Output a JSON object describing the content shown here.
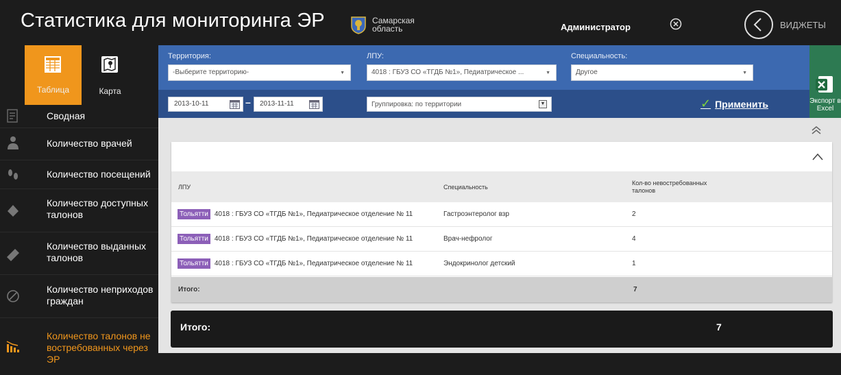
{
  "header": {
    "app_title": "Статистика для мониторинга ЭР",
    "region": "Самарская область",
    "user": "Администратор",
    "widgets": "ВИДЖЕТЫ"
  },
  "views": {
    "table_label": "Таблица",
    "map_label": "Карта"
  },
  "nav": [
    {
      "label": "Сводная",
      "icon": "summary-icon"
    },
    {
      "label": "Количество врачей",
      "icon": "doctor-icon"
    },
    {
      "label": "Количество посещений",
      "icon": "footprints-icon"
    },
    {
      "label": "Количество доступных талонов",
      "icon": "ticket-icon"
    },
    {
      "label": "Количество выданных талонов",
      "icon": "ticket-issued-icon"
    },
    {
      "label": "Количество неприходов граждан",
      "icon": "no-show-icon"
    },
    {
      "label": "Количество талонов не востребованных через ЭР",
      "icon": "unclaimed-chart-icon",
      "active": true
    }
  ],
  "filters": {
    "territory_label": "Территория:",
    "territory_value": "-Выберите территорию-",
    "lpu_label": "ЛПУ:",
    "lpu_value": "4018 : ГБУЗ СО «ТГДБ №1», Педиатрическое ...",
    "specialty_label": "Специальность:",
    "specialty_value": "Другое",
    "date_from": "2013-10-11",
    "date_to": "2013-11-11",
    "grouping": "Группировка: по территории",
    "apply": "Применить",
    "export": "Экспорт в Excel"
  },
  "table": {
    "columns": [
      "ЛПУ",
      "Специальность",
      "Кол-во невостребованных талонов"
    ],
    "rows": [
      {
        "city": "Тольятти",
        "lpu": "4018 : ГБУЗ СО «ТГДБ №1», Педиатрическое отделение № 11",
        "specialty": "Гастроэнтеролог взр",
        "count": "2"
      },
      {
        "city": "Тольятти",
        "lpu": "4018 : ГБУЗ СО «ТГДБ №1», Педиатрическое отделение № 11",
        "specialty": "Врач-нефролог",
        "count": "4"
      },
      {
        "city": "Тольятти",
        "lpu": "4018 : ГБУЗ СО «ТГДБ №1», Педиатрическое отделение № 11",
        "specialty": "Эндокринолог детский",
        "count": "1"
      }
    ],
    "total_label": "Итого:",
    "total_value": "7"
  },
  "grand_total": {
    "label": "Итого:",
    "value": "7"
  },
  "colors": {
    "accent": "#f0961c",
    "filter_bar": "#3c69b0",
    "export": "#2d7a52",
    "city_badge": "#8c5fb8",
    "apply_check": "#7fd43b"
  }
}
